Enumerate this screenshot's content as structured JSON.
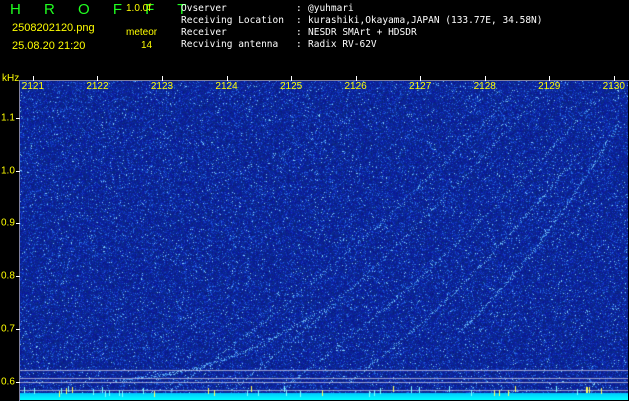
{
  "header": {
    "title": "H R O F F T",
    "version": "1.0.0f",
    "filename": "2508202120.png",
    "mode": "meteor",
    "datetime": "25.08.20 21:20",
    "count": "14"
  },
  "info": [
    {
      "label": "Ovserver",
      "value": "@yuhmari"
    },
    {
      "label": "Receiving Location",
      "value": "kurashiki,Okayama,JAPAN (133.77E, 34.58N)"
    },
    {
      "label": "Receiver",
      "value": "NESDR SMArt + HDSDR"
    },
    {
      "label": "Recviving antenna",
      "value": "Radix RV-62V"
    }
  ],
  "colors": {
    "title": "#20ff20",
    "labels": "#ffff00",
    "info": "#ffffff",
    "background": "#000000",
    "spectrum_base": "#0a1c9a",
    "noise_floor": "#00ffff"
  },
  "chart_data": {
    "type": "heatmap",
    "x_ticks": [
      "2121",
      "2122",
      "2123",
      "2124",
      "2125",
      "2126",
      "2127",
      "2128",
      "2129",
      "2130"
    ],
    "y_unit": "kHz",
    "y_ticks": [
      "1.1",
      "1.0",
      "0.9",
      "0.8",
      "0.7",
      "0.6"
    ],
    "y_values": [
      1.1,
      1.0,
      0.9,
      0.8,
      0.7,
      0.6
    ],
    "xlim": [
      2120.8,
      2130.22
    ],
    "ylim": [
      0.565,
      1.17
    ]
  }
}
